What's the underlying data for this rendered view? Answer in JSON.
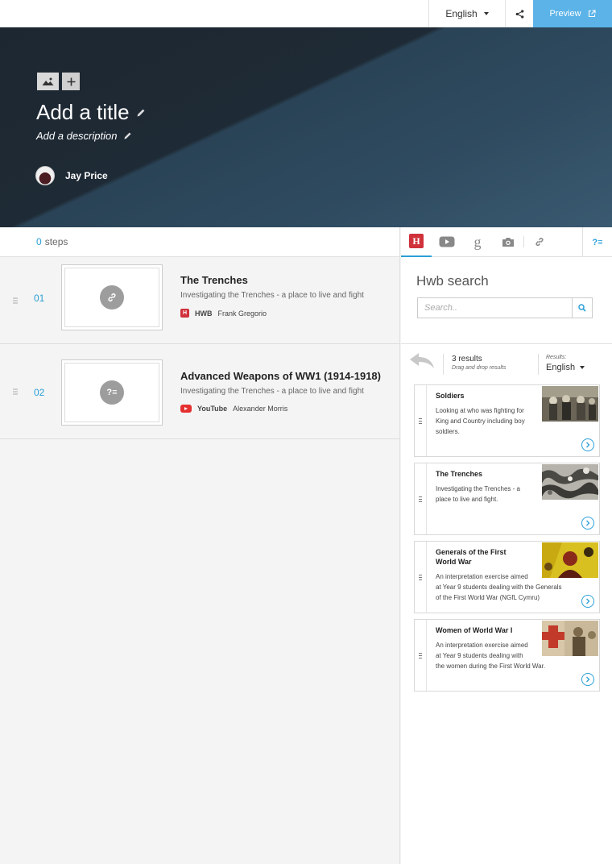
{
  "topbar": {
    "language": "English",
    "share_icon": "share-icon",
    "preview_label": "Preview",
    "preview_icon": "external-link-icon"
  },
  "hero": {
    "title": "Add a title",
    "description": "Add a description",
    "author": "Jay Price",
    "add_image_icon": "image-icon",
    "add_icon": "plus-icon"
  },
  "steps": {
    "count": "0",
    "label": "steps",
    "items": [
      {
        "number": "01",
        "title": "The Trenches",
        "subtitle": "Investigating the Trenches - a place to live and fight",
        "source": "HWB",
        "author": "Frank Gregorio",
        "thumb_icon": "link-icon"
      },
      {
        "number": "02",
        "title": "Advanced Weapons of WW1 (1914-1918)",
        "subtitle": "Investigating the Trenches - a place to live and fight",
        "source": "YouTube",
        "author": "Alexander Morris",
        "thumb_icon": "quiz-icon"
      }
    ]
  },
  "panel": {
    "tabs": [
      "hwb-icon",
      "youtube-icon",
      "google-icon",
      "camera-icon",
      "link-icon"
    ],
    "quiz_tab": "?≡",
    "search_title": "Hwb search",
    "search_placeholder": "Search..",
    "results_count": "3 results",
    "results_hint": "Drag and drop results",
    "results_label": "Results:",
    "results_language": "English",
    "results": [
      {
        "title": "Soldiers",
        "desc": [
          "Looking at who was fighting for",
          "King and Country including boy",
          "soldiers."
        ]
      },
      {
        "title": "The Trenches",
        "desc": [
          "Investigating the Trenches - a",
          "place to live and fight."
        ]
      },
      {
        "title": "Generals of the First World War",
        "desc": [
          "An interpretation exercise aimed",
          "at Year 9 students dealing with the Generals",
          "of the First World War (NGfL Cymru)"
        ]
      },
      {
        "title": "Women of World War I",
        "desc": [
          "An interpretation exercise aimed",
          "at Year 9 students dealing with",
          "the women during the First World War."
        ]
      }
    ]
  },
  "colors": {
    "accent": "#2a9fd6",
    "preview": "#5bb3e8",
    "hwb_red": "#d0313b",
    "youtube_red": "#e53030"
  }
}
